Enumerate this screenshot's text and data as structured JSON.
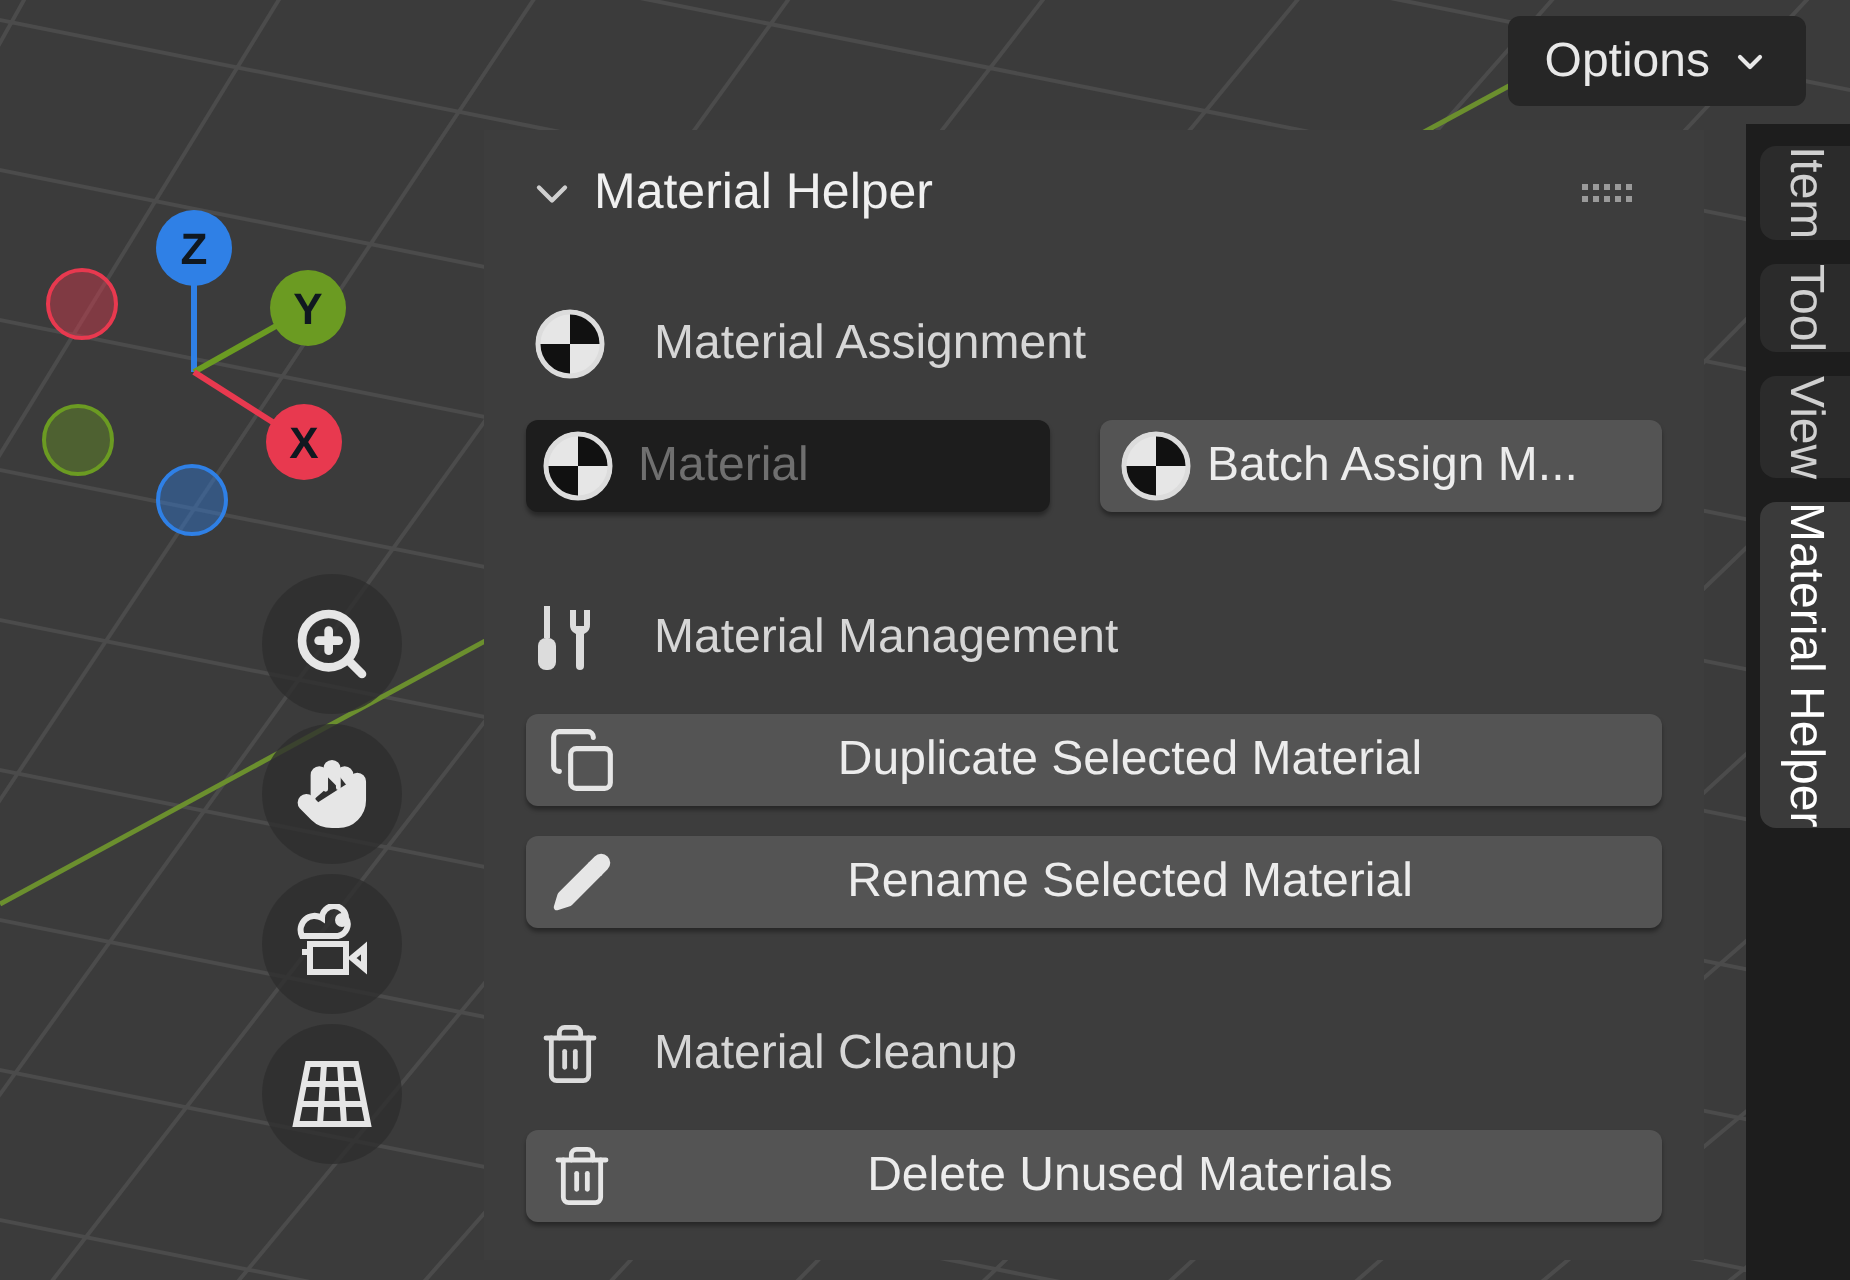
{
  "gizmo": {
    "axes": [
      {
        "label": "Z",
        "color": "#2f80e6"
      },
      {
        "label": "Y",
        "color": "#6b9b22"
      },
      {
        "label": "X",
        "color": "#e8394f"
      }
    ]
  },
  "header": {
    "options_button": "Options"
  },
  "panel": {
    "title": "Material Helper",
    "expanded": true,
    "sections": [
      {
        "heading": "Material Assignment",
        "controls": [
          {
            "kind": "field",
            "placeholder": "Material"
          },
          {
            "kind": "button",
            "label": "Batch Assign M..."
          }
        ]
      },
      {
        "heading": "Material Management",
        "controls": [
          {
            "kind": "wide_button",
            "label": "Duplicate Selected Material"
          },
          {
            "kind": "wide_button",
            "label": "Rename Selected Material"
          }
        ]
      },
      {
        "heading": "Material Cleanup",
        "controls": [
          {
            "kind": "wide_button",
            "label": "Delete Unused Materials"
          }
        ]
      }
    ]
  },
  "tabs": [
    {
      "label": "Item",
      "selected": false
    },
    {
      "label": "Tool",
      "selected": false
    },
    {
      "label": "View",
      "selected": false
    },
    {
      "label": "Material Helper",
      "selected": true
    }
  ]
}
